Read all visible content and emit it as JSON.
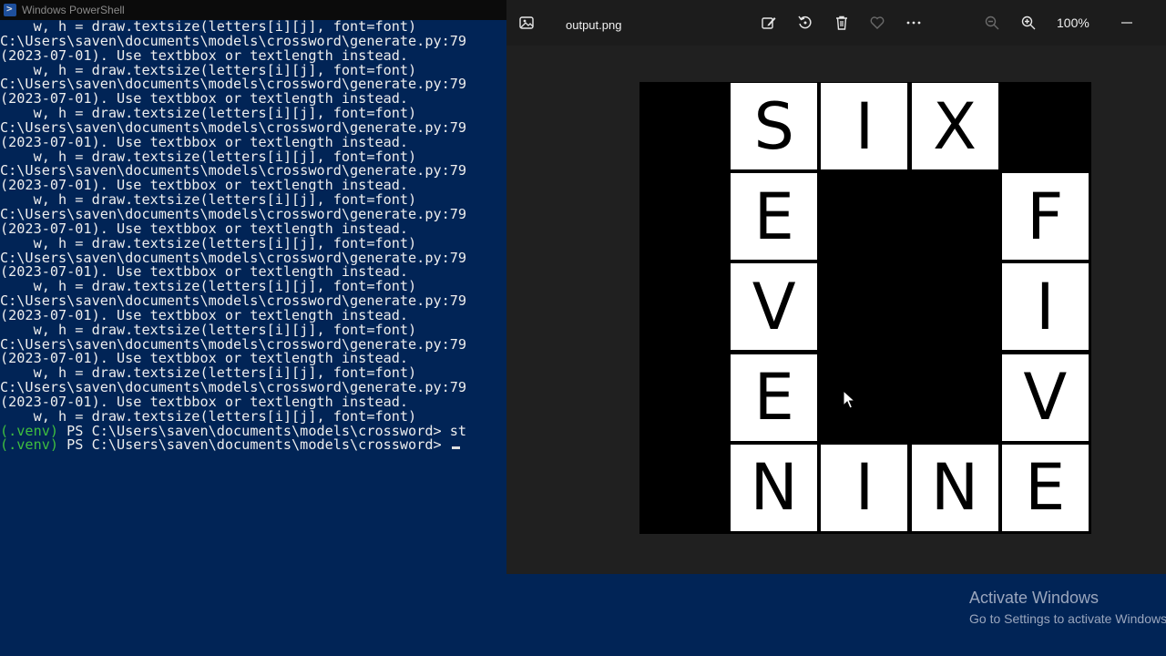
{
  "powershell": {
    "title": "Windows PowerShell",
    "lines": [
      "    w, h = draw.textsize(letters[i][j], font=font)",
      "C:\\Users\\saven\\documents\\models\\crossword\\generate.py:79",
      "(2023-07-01). Use textbbox or textlength instead.",
      "    w, h = draw.textsize(letters[i][j], font=font)",
      "C:\\Users\\saven\\documents\\models\\crossword\\generate.py:79",
      "(2023-07-01). Use textbbox or textlength instead.",
      "    w, h = draw.textsize(letters[i][j], font=font)",
      "C:\\Users\\saven\\documents\\models\\crossword\\generate.py:79",
      "(2023-07-01). Use textbbox or textlength instead.",
      "    w, h = draw.textsize(letters[i][j], font=font)",
      "C:\\Users\\saven\\documents\\models\\crossword\\generate.py:79",
      "(2023-07-01). Use textbbox or textlength instead.",
      "    w, h = draw.textsize(letters[i][j], font=font)",
      "C:\\Users\\saven\\documents\\models\\crossword\\generate.py:79",
      "(2023-07-01). Use textbbox or textlength instead.",
      "    w, h = draw.textsize(letters[i][j], font=font)",
      "C:\\Users\\saven\\documents\\models\\crossword\\generate.py:79",
      "(2023-07-01). Use textbbox or textlength instead.",
      "    w, h = draw.textsize(letters[i][j], font=font)",
      "C:\\Users\\saven\\documents\\models\\crossword\\generate.py:79",
      "(2023-07-01). Use textbbox or textlength instead.",
      "    w, h = draw.textsize(letters[i][j], font=font)",
      "C:\\Users\\saven\\documents\\models\\crossword\\generate.py:79",
      "(2023-07-01). Use textbbox or textlength instead.",
      "    w, h = draw.textsize(letters[i][j], font=font)",
      "C:\\Users\\saven\\documents\\models\\crossword\\generate.py:79",
      "(2023-07-01). Use textbbox or textlength instead.",
      "    w, h = draw.textsize(letters[i][j], font=font)"
    ],
    "prompts": [
      {
        "venv": "(.venv)",
        "text": " PS C:\\Users\\saven\\documents\\models\\crossword> st",
        "cursor": false
      },
      {
        "venv": "(.venv)",
        "text": " PS C:\\Users\\saven\\documents\\models\\crossword> ",
        "cursor": true
      }
    ]
  },
  "viewer": {
    "filename": "output.png",
    "zoom": "100%",
    "icons": [
      "image-icon",
      "edit-image-icon",
      "rotate-icon",
      "delete-icon",
      "favorite-heart-icon",
      "more-options-icon",
      "zoom-out-icon",
      "zoom-in-icon",
      "minimize-icon"
    ],
    "crossword": {
      "rows": 5,
      "cols": 5,
      "cells": [
        [
          null,
          "S",
          "I",
          "X",
          null
        ],
        [
          null,
          "E",
          null,
          null,
          "F"
        ],
        [
          null,
          "V",
          null,
          null,
          "I"
        ],
        [
          null,
          "E",
          null,
          null,
          "V"
        ],
        [
          null,
          "N",
          "I",
          "N",
          "E"
        ]
      ]
    }
  },
  "watermark": {
    "title": "Activate Windows",
    "subtitle": "Go to Settings to activate Windows."
  },
  "colors": {
    "terminal_bg": "#012456",
    "viewer_bg": "#202020",
    "venv_green": "#3fbf3f"
  }
}
